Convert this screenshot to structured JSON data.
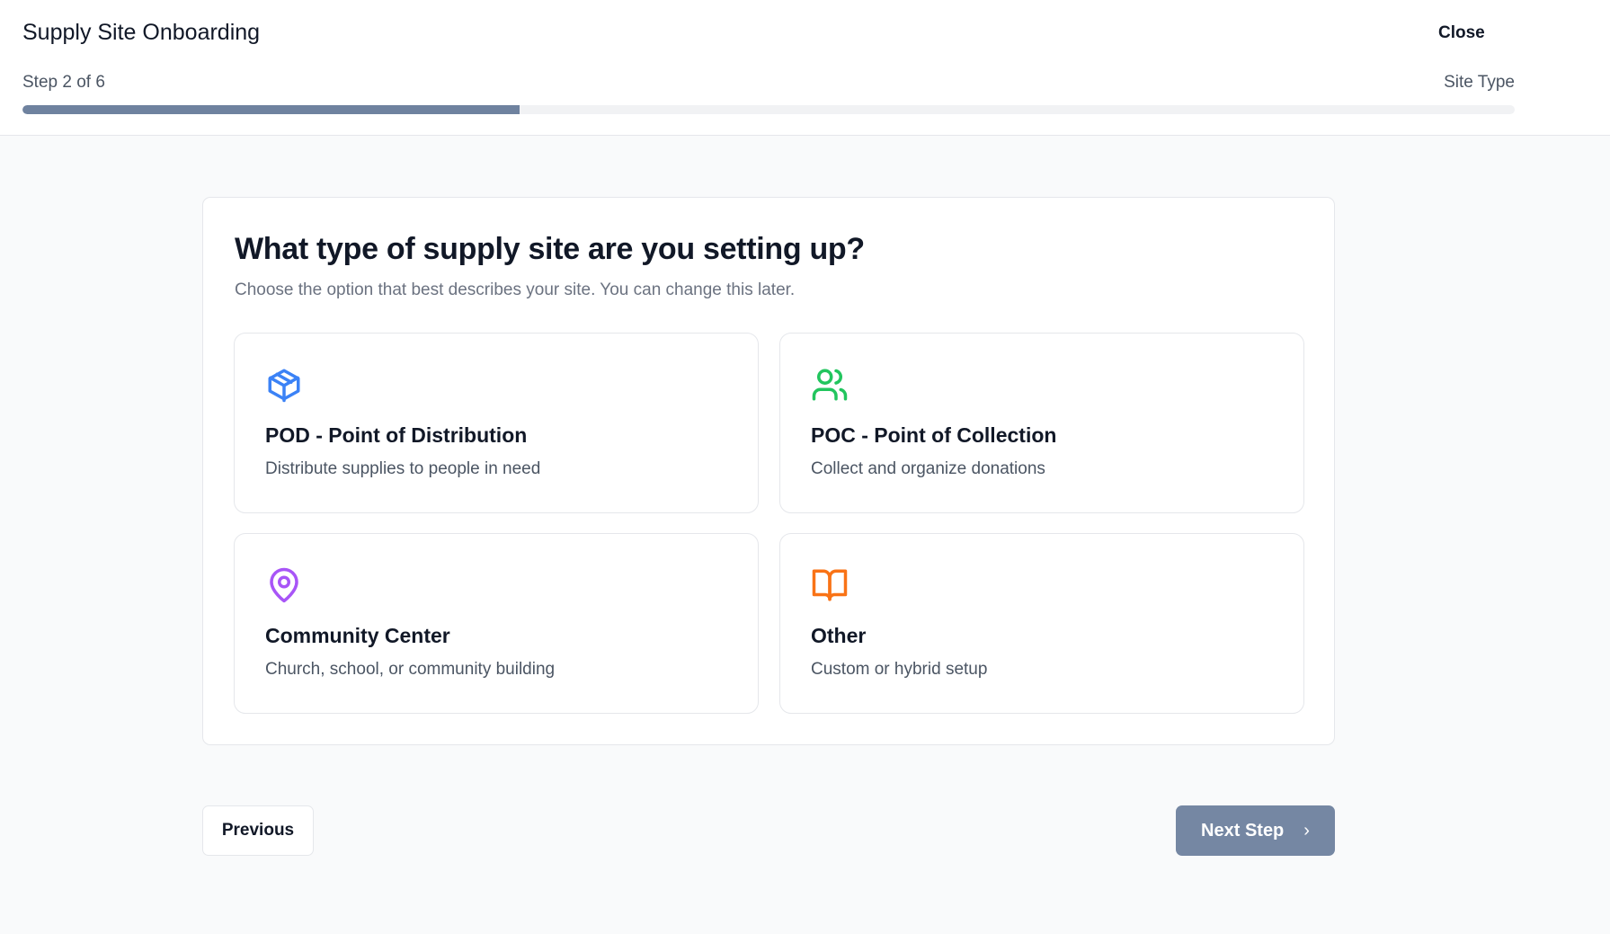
{
  "header": {
    "title": "Supply Site Onboarding",
    "close_label": "Close",
    "step_label": "Step 2 of 6",
    "step_name": "Site Type",
    "progress_fraction": 0.3333
  },
  "main": {
    "title": "What type of supply site are you setting up?",
    "subtitle": "Choose the option that best describes your site. You can change this later.",
    "options": [
      {
        "icon": "package-icon",
        "title": "POD - Point of Distribution",
        "description": "Distribute supplies to people in need",
        "color": "#3b82f6"
      },
      {
        "icon": "users-icon",
        "title": "POC - Point of Collection",
        "description": "Collect and organize donations",
        "color": "#22c55e"
      },
      {
        "icon": "map-pin-icon",
        "title": "Community Center",
        "description": "Church, school, or community building",
        "color": "#a855f7"
      },
      {
        "icon": "book-open-icon",
        "title": "Other",
        "description": "Custom or hybrid setup",
        "color": "#f97316"
      }
    ]
  },
  "footer": {
    "previous_label": "Previous",
    "next_label": "Next Step",
    "next_icon": "chevron-right-icon"
  },
  "colors": {
    "progress": "#6f829f",
    "next_button": "#7587a3"
  }
}
